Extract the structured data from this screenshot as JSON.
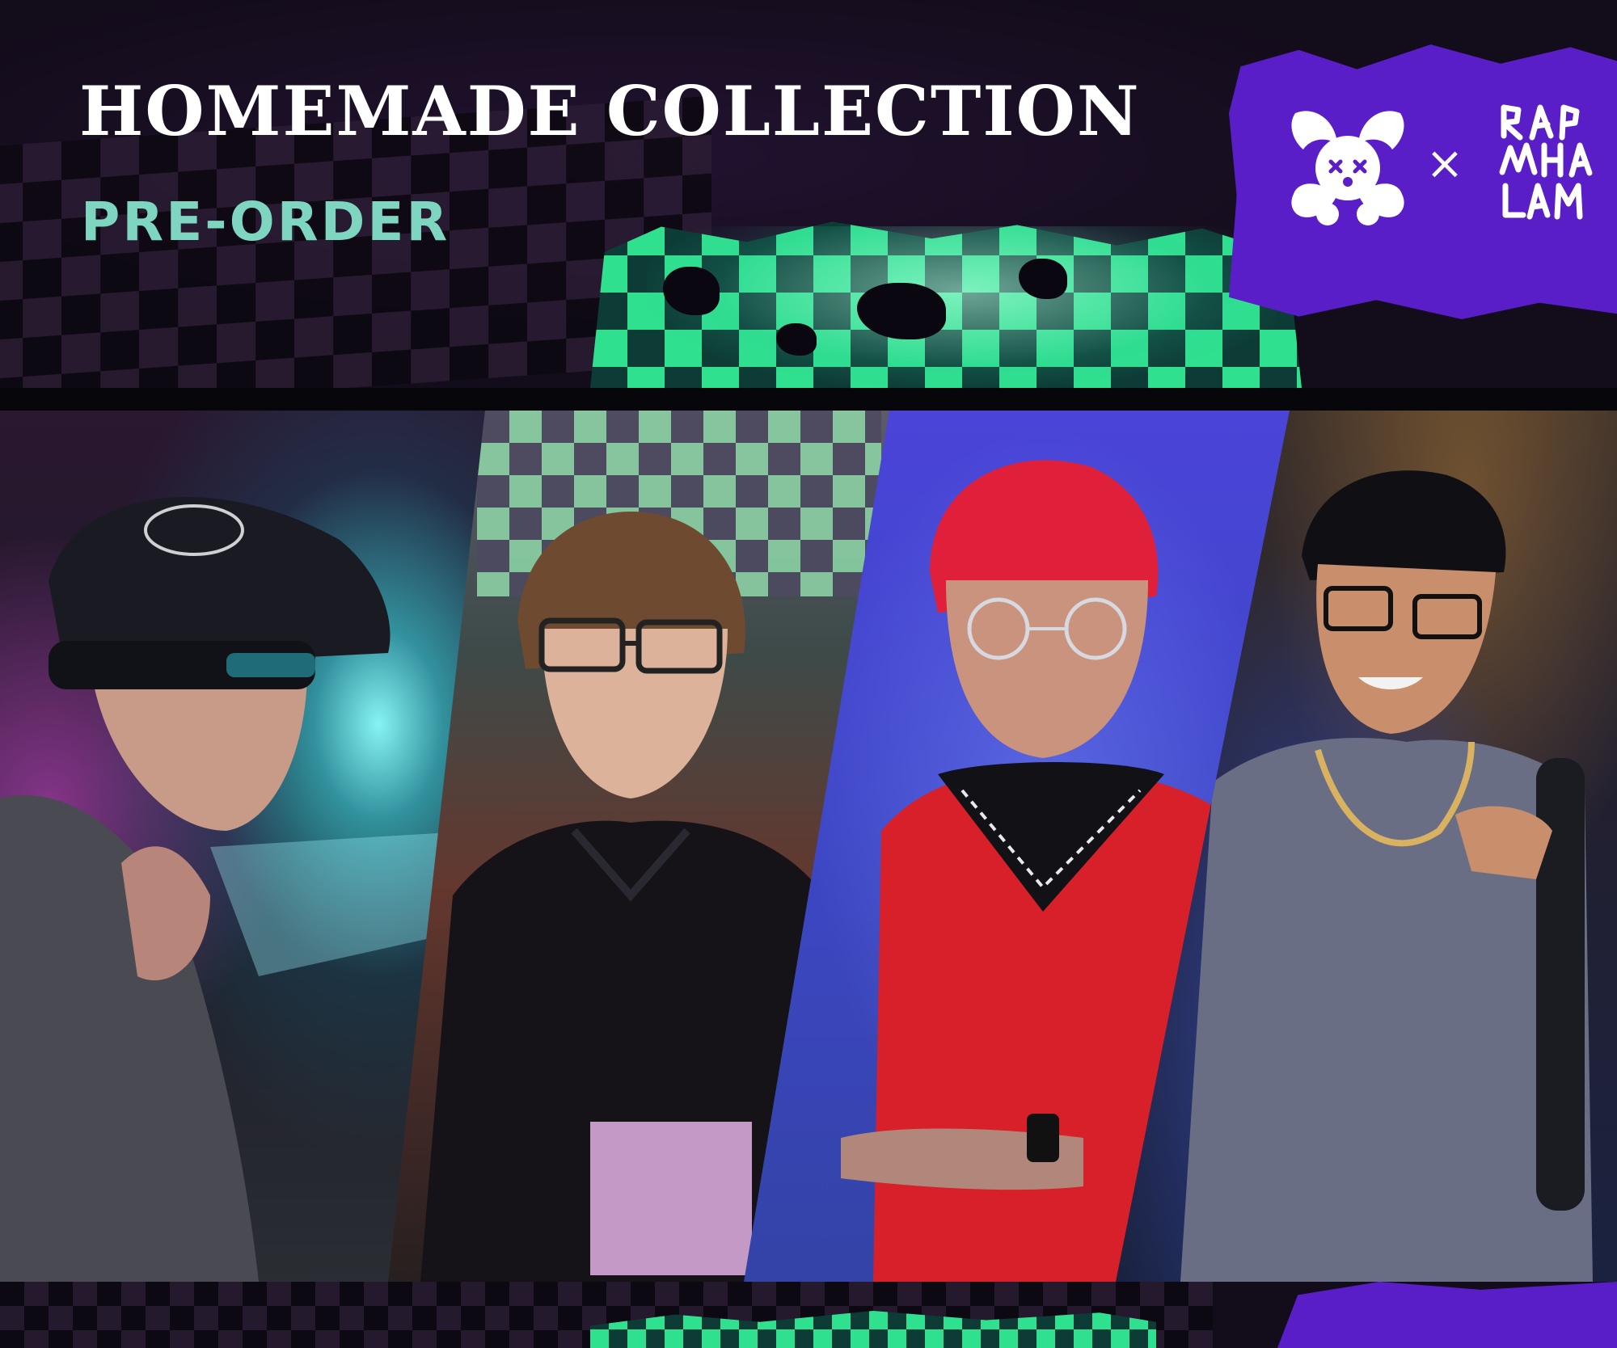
{
  "header": {
    "title": "HOMEMADE COLLECTION",
    "subtitle": "PRE-ORDER",
    "collab_separator": "×"
  },
  "logos": {
    "left": "clown-smile-face-logo",
    "right": "rap-viet-graffiti-logo"
  },
  "colors": {
    "background": "#130c1a",
    "title": "#ffffff",
    "subtitle": "#7fd6c0",
    "accent_purple": "#5a1ec9",
    "accent_green": "#2fe08e"
  },
  "panels": [
    {
      "id": "model-1",
      "description_icon": "person-cap-sunglasses-icon"
    },
    {
      "id": "model-2",
      "description_icon": "person-glasses-hoodie-icon"
    },
    {
      "id": "model-3",
      "description_icon": "person-red-hair-bandana-icon"
    },
    {
      "id": "model-4",
      "description_icon": "person-glasses-chain-icon"
    }
  ]
}
